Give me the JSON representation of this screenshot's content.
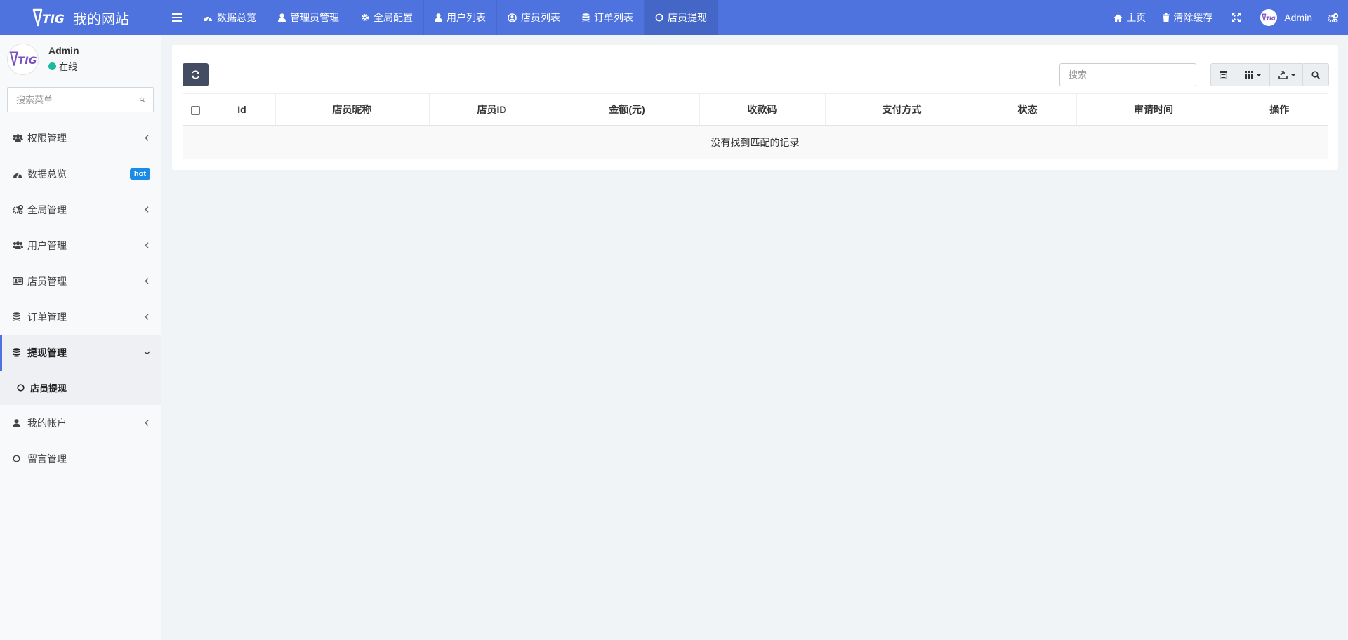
{
  "header": {
    "site_name": "我的网站",
    "logo_text": "TIGI",
    "tabs": [
      {
        "label": "数据总览",
        "icon": "dashboard-icon"
      },
      {
        "label": "管理员管理",
        "icon": "user-icon"
      },
      {
        "label": "全局配置",
        "icon": "gear-icon"
      },
      {
        "label": "用户列表",
        "icon": "user-icon"
      },
      {
        "label": "店员列表",
        "icon": "user-circle-icon"
      },
      {
        "label": "订单列表",
        "icon": "database-icon"
      },
      {
        "label": "店员提现",
        "icon": "circle-icon",
        "active": true
      }
    ],
    "right": {
      "home_label": "主页",
      "clear_cache_label": "清除缓存",
      "admin_name": "Admin"
    }
  },
  "sidebar": {
    "user": {
      "name": "Admin",
      "status": "在线"
    },
    "search_placeholder": "搜索菜单",
    "items": [
      {
        "label": "权限管理",
        "icon": "users-icon"
      },
      {
        "label": "数据总览",
        "icon": "dashboard-icon",
        "badge": "hot"
      },
      {
        "label": "全局管理",
        "icon": "cogs-icon"
      },
      {
        "label": "用户管理",
        "icon": "users-icon"
      },
      {
        "label": "店员管理",
        "icon": "id-card-icon"
      },
      {
        "label": "订单管理",
        "icon": "database-icon"
      },
      {
        "label": "提现管理",
        "icon": "database-icon",
        "open": true,
        "children": [
          {
            "label": "店员提现",
            "icon": "circle-icon"
          }
        ]
      },
      {
        "label": "我的帐户",
        "icon": "user-icon"
      },
      {
        "label": "留言管理",
        "icon": "circle-icon"
      }
    ]
  },
  "main": {
    "search_placeholder": "搜索",
    "table": {
      "columns": [
        "Id",
        "店员昵称",
        "店员ID",
        "金额(元)",
        "收款码",
        "支付方式",
        "状态",
        "审请时间",
        "操作"
      ],
      "empty_text": "没有找到匹配的记录"
    }
  },
  "colors": {
    "accent": "#4e73df",
    "online": "#18bc9c",
    "badge": "#1a8ce8",
    "refresh_button": "#444c63"
  }
}
